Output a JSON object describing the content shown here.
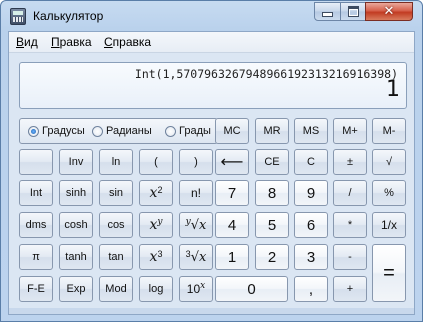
{
  "window": {
    "title": "Калькулятор",
    "close_glyph": "✕"
  },
  "menu": [
    {
      "label": "Вид",
      "accel": "В",
      "rest": "ид"
    },
    {
      "label": "Правка",
      "accel": "П",
      "rest": "равка"
    },
    {
      "label": "Справка",
      "accel": "С",
      "rest": "правка"
    }
  ],
  "display": {
    "expression": "Int(1,5707963267948966192313216916398)",
    "value": "1"
  },
  "angle_mode": {
    "options": [
      "Градусы",
      "Радианы",
      "Грады"
    ],
    "selected": "Градусы"
  },
  "memory_buttons": [
    "MC",
    "MR",
    "MS",
    "M+",
    "M-"
  ],
  "buttons": {
    "inv": "Inv",
    "ln": "ln",
    "lparen": "(",
    "rparen": ")",
    "backspace": "⟵",
    "ce": "CE",
    "c": "C",
    "plusminus": "±",
    "sqrt": "√",
    "int": "Int",
    "sinh": "sinh",
    "sin": "sin",
    "x2_base": "x",
    "x2_exp": "2",
    "fact": "n!",
    "d7": "7",
    "d8": "8",
    "d9": "9",
    "div": "/",
    "pct": "%",
    "dms": "dms",
    "cosh": "cosh",
    "cos": "cos",
    "xy_base": "x",
    "xy_exp": "y",
    "yroot": "√x",
    "yroot_idx": "y",
    "d4": "4",
    "d5": "5",
    "d6": "6",
    "mul": "*",
    "recip": "1/x",
    "pi": "π",
    "tanh": "tanh",
    "tan": "tan",
    "x3_base": "x",
    "x3_exp": "3",
    "cuberoot": "√x",
    "cuberoot_idx": "3",
    "d1": "1",
    "d2": "2",
    "d3": "3",
    "sub": "-",
    "eq": "=",
    "fe": "F-E",
    "exp": "Exp",
    "mod": "Mod",
    "log": "log",
    "tenx_base": "10",
    "tenx_exp": "x",
    "d0": "0",
    "dot": ",",
    "add": "+"
  }
}
